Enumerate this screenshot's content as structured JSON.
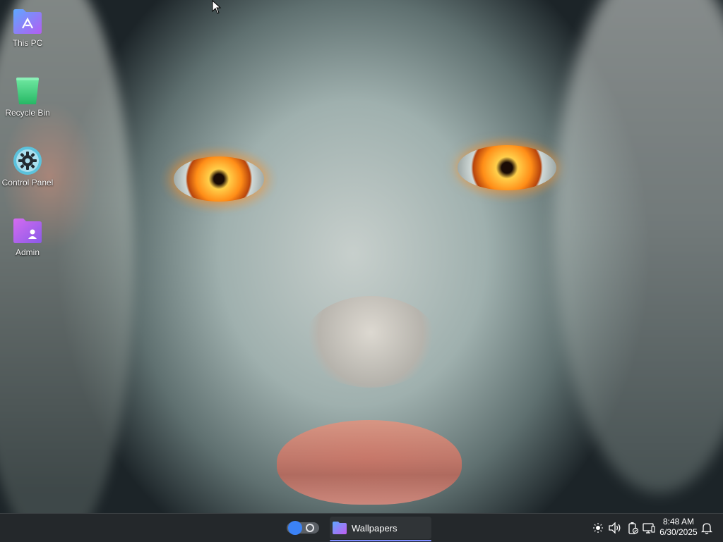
{
  "desktop": {
    "wallpaper": "portrait-with-glowing-orange-eyes",
    "icons": [
      {
        "label": "This PC",
        "icon": "this-pc-folder-icon",
        "color": "#8f6cf2"
      },
      {
        "label": "Recycle Bin",
        "icon": "recycle-bin-icon",
        "color": "#3ecf7d"
      },
      {
        "label": "Control Panel",
        "icon": "gear-icon",
        "color": "#4bb8d6"
      },
      {
        "label": "Admin",
        "icon": "user-folder-icon",
        "color": "#b06ae8"
      }
    ]
  },
  "taskbar": {
    "background": "#24282b",
    "toggle_icon": "theme-toggle-icon",
    "toggle_color": "#3b82f6",
    "tasks": [
      {
        "label": "Wallpapers",
        "icon": "wallpapers-app-icon",
        "accent": "#7d8cff"
      }
    ],
    "tray": {
      "icons": [
        "brightness-icon",
        "volume-icon",
        "battery-icon",
        "network-icon"
      ],
      "time": "8:48 AM",
      "date": "6/30/2025",
      "notification_icon": "bell-icon"
    }
  }
}
